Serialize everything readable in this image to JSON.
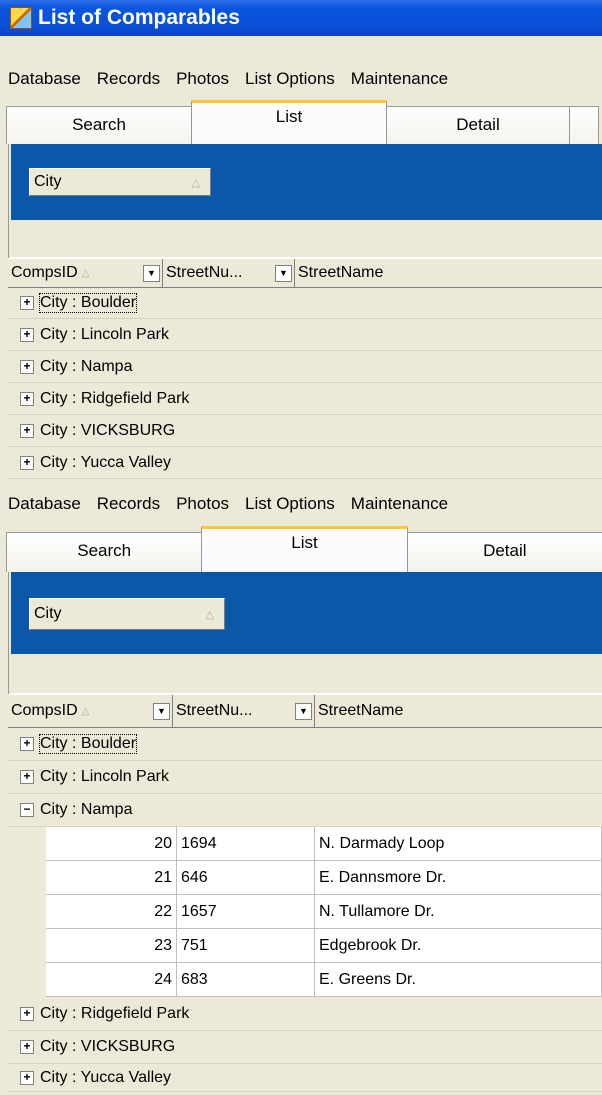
{
  "window": {
    "title": "List of Comparables"
  },
  "menu": [
    "Database",
    "Records",
    "Photos",
    "List Options",
    "Maintenance"
  ],
  "tabs": [
    {
      "label": "Search",
      "active": false
    },
    {
      "label": "List",
      "active": true
    },
    {
      "label": "Detail",
      "active": false
    }
  ],
  "group_by": {
    "label": "City"
  },
  "columns": [
    "CompsID",
    "StreetNu...",
    "StreetName"
  ],
  "collapsed_view": {
    "groups": [
      {
        "label": "City : Boulder",
        "expanded": false
      },
      {
        "label": "City : Lincoln Park",
        "expanded": false
      },
      {
        "label": "City : Nampa",
        "expanded": false
      },
      {
        "label": "City : Ridgefield Park",
        "expanded": false
      },
      {
        "label": "City : VICKSBURG",
        "expanded": false
      },
      {
        "label": "City : Yucca Valley",
        "expanded": false
      }
    ]
  },
  "expanded_view": {
    "groups": [
      {
        "label": "City : Boulder",
        "expanded": false
      },
      {
        "label": "City : Lincoln Park",
        "expanded": false
      },
      {
        "label": "City : Nampa",
        "expanded": true,
        "rows": [
          {
            "id": "20",
            "num": "1694",
            "street": "N. Darmady Loop"
          },
          {
            "id": "21",
            "num": "646",
            "street": "E. Dannsmore Dr."
          },
          {
            "id": "22",
            "num": "1657",
            "street": "N. Tullamore Dr."
          },
          {
            "id": "23",
            "num": "751",
            "street": "Edgebrook Dr."
          },
          {
            "id": "24",
            "num": "683",
            "street": "E. Greens Dr."
          }
        ]
      },
      {
        "label": "City : Ridgefield Park",
        "expanded": false
      },
      {
        "label": "City : VICKSBURG",
        "expanded": false
      },
      {
        "label": "City : Yucca Valley",
        "expanded": false
      }
    ]
  },
  "colors": {
    "titlebar": "#0a4fd6",
    "groupbar": "#0b58a8",
    "tab_highlight": "#ffc83c"
  }
}
